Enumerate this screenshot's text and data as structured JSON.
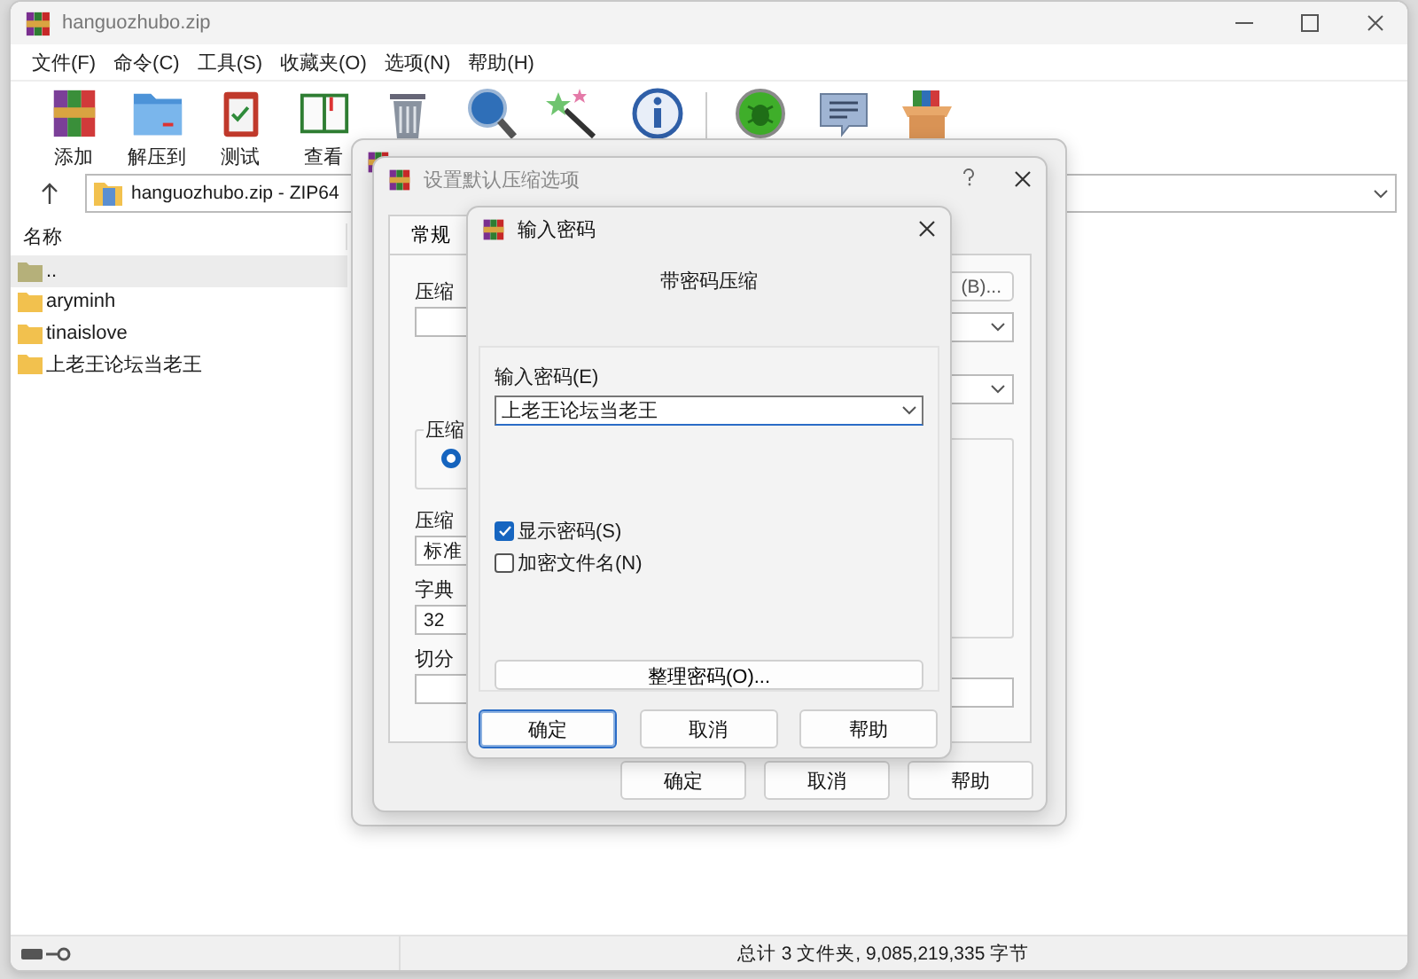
{
  "window": {
    "title": "hanguozhubo.zip"
  },
  "menu": [
    {
      "label": "文件(F)"
    },
    {
      "label": "命令(C)"
    },
    {
      "label": "工具(S)"
    },
    {
      "label": "收藏夹(O)"
    },
    {
      "label": "选项(N)"
    },
    {
      "label": "帮助(H)"
    }
  ],
  "toolbar": [
    {
      "kind": "add",
      "label": "添加"
    },
    {
      "kind": "extract",
      "label": "解压到"
    },
    {
      "kind": "test",
      "label": "测试"
    },
    {
      "kind": "view",
      "label": "查看"
    },
    {
      "kind": "delete"
    },
    {
      "kind": "find"
    },
    {
      "kind": "wizard"
    },
    {
      "kind": "info"
    },
    {
      "kind": "virus"
    },
    {
      "kind": "comment"
    },
    {
      "kind": "sfx"
    }
  ],
  "address": {
    "path": "hanguozhubo.zip - ZIP64"
  },
  "file_list": {
    "columns": [
      "名称"
    ],
    "rows": [
      {
        "name": "..",
        "kind": "parent",
        "selected": true
      },
      {
        "name": "aryminh",
        "kind": "folder",
        "selected": false
      },
      {
        "name": "tinaislove",
        "kind": "folder",
        "selected": false
      },
      {
        "name": "上老王论坛当老王",
        "kind": "folder",
        "selected": false
      }
    ]
  },
  "status_bar": {
    "summary": "总计 3 文件夹, 9,085,219,335 字节"
  },
  "options_dialog": {
    "title": "设置默认压缩选项",
    "tabs": [
      {
        "label": "常规",
        "selected": true
      }
    ],
    "archive_name_label": "压缩",
    "browse_button": "(B)...",
    "group_label": "压缩",
    "radio_selected": true,
    "method_label": "压缩",
    "method_value": "标准",
    "dictionary_label": "字典",
    "dictionary_value": "32",
    "split_label": "切分",
    "buttons": [
      "确定",
      "取消",
      "帮助"
    ]
  },
  "password_dialog": {
    "title": "输入密码",
    "heading": "带密码压缩",
    "password_label": "输入密码(E)",
    "password_value": "上老王论坛当老王",
    "options": [
      {
        "label": "显示密码(S)",
        "checked": true
      },
      {
        "label": "加密文件名(N)",
        "checked": false
      }
    ],
    "manage_button": "整理密码(O)...",
    "buttons": [
      {
        "label": "确定",
        "default": true
      },
      {
        "label": "取消",
        "default": false
      },
      {
        "label": "帮助",
        "default": false
      }
    ]
  }
}
